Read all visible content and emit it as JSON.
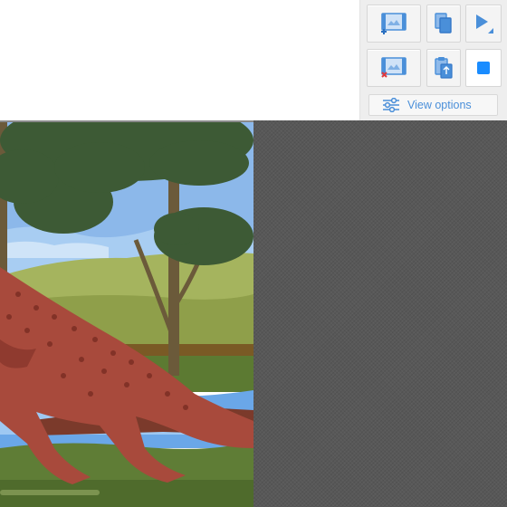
{
  "toolbar": {
    "buttons": [
      {
        "icon": "add-slide-icon"
      },
      {
        "icon": "copy-icon"
      },
      {
        "icon": "play-icon"
      },
      {
        "icon": "remove-slide-icon"
      },
      {
        "icon": "paste-icon"
      },
      {
        "icon": "stop-icon"
      }
    ],
    "view_options_label": "View options"
  },
  "colors": {
    "accent": "#4a8fd9",
    "stop": "#1a8cff",
    "canvas_bg": "#585858"
  }
}
